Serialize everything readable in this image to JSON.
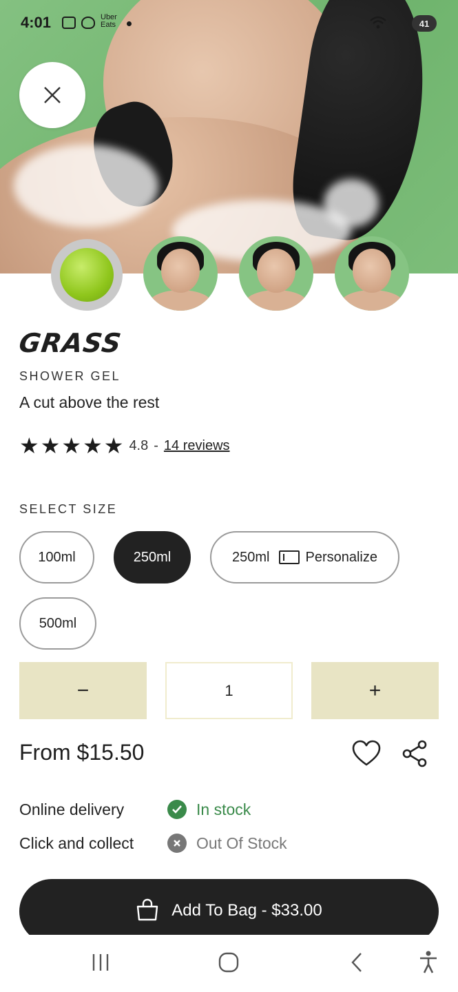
{
  "status_bar": {
    "time": "4:01",
    "app_badge": "Uber Eats",
    "battery": "41"
  },
  "product": {
    "name": "GRASS",
    "category": "SHOWER GEL",
    "tagline": "A cut above the rest",
    "rating": {
      "stars": 5,
      "score": "4.8",
      "separator": "-",
      "reviews_label": "14 reviews"
    },
    "gallery": [
      "gel-thumbnail",
      "model-photo-1",
      "model-photo-2",
      "model-photo-3"
    ]
  },
  "size": {
    "label": "SELECT SIZE",
    "options": [
      {
        "label": "100ml",
        "selected": false
      },
      {
        "label": "250ml",
        "selected": true
      },
      {
        "label": "250ml",
        "extra": "Personalize",
        "selected": false
      },
      {
        "label": "500ml",
        "selected": false
      }
    ]
  },
  "quantity": {
    "minus": "−",
    "value": "1",
    "plus": "+"
  },
  "price": "From $15.50",
  "availability": {
    "online": {
      "label": "Online delivery",
      "status": "In stock"
    },
    "collect": {
      "label": "Click and collect",
      "status": "Out Of Stock"
    }
  },
  "cta": {
    "label": "Add To Bag - $33.00"
  },
  "colors": {
    "accent_dark": "#222222",
    "quantity_bg": "#e8e4c4",
    "in_stock": "#3a8a4a",
    "out_of_stock": "#777777",
    "hero_bg": "#7dbd7a"
  },
  "icons": {
    "close": "close-icon",
    "wishlist": "heart-icon",
    "share": "share-icon",
    "bag": "shopping-bag-icon"
  }
}
